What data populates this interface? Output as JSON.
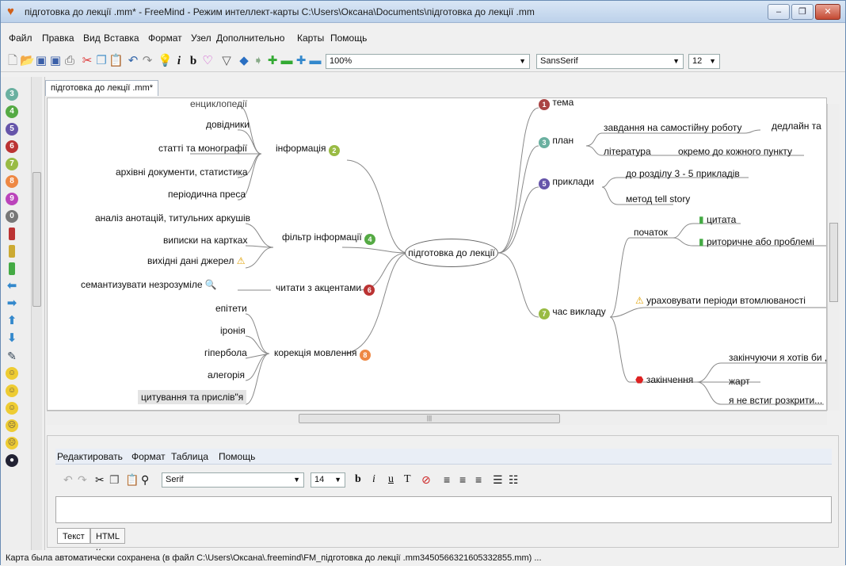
{
  "window": {
    "title": "підготовка до лекції .mm* - FreeMind - Режим интеллект-карты C:\\Users\\Оксана\\Documents\\підготовка до лекції .mm",
    "minimize": "–",
    "maximize": "❐",
    "close": "✕"
  },
  "menu": [
    "Файл",
    "Правка",
    "Вид",
    "Вставка",
    "Формат",
    "Узел",
    "Дополнительно",
    "Карты",
    "Помощь"
  ],
  "toolbar": {
    "zoom": "100%",
    "font": "SansSerif",
    "size": "12"
  },
  "tab": "підготовка до лекції .mm*",
  "map": {
    "central": "підготовка до лекції",
    "left": {
      "info": {
        "label": "інформація",
        "icon": "2",
        "children": [
          "енциклопедії",
          "довідники",
          "статті та монографії",
          "архівні документи, статистика",
          "періодична преса"
        ]
      },
      "filter": {
        "label": "фільтр інформації",
        "icon": "4",
        "children": [
          "аналіз анотацій, титульних аркушів",
          "виписки на картках",
          "вихідні дані джерел"
        ]
      },
      "read": {
        "label": "читати з акцентами",
        "icon": "6",
        "children": [
          "семантизувати незрозуміле"
        ]
      },
      "speech": {
        "label": "корекція мовлення",
        "icon": "8",
        "children": [
          "епітети",
          "іронія",
          "гіпербола",
          "алегорія",
          "цитування та прислів\"я"
        ]
      }
    },
    "right": {
      "theme": {
        "label": "тема",
        "icon": "1"
      },
      "plan": {
        "label": "план",
        "icon": "3",
        "children": [
          "завдання на самостійну роботу",
          "література"
        ],
        "grand": [
          "дедлайн та",
          "окремо до кожного пункту"
        ]
      },
      "examples": {
        "label": "приклади",
        "icon": "5",
        "children": [
          "до розділу 3 - 5 прикладів",
          "метод tell story"
        ]
      },
      "time": {
        "label": "час викладу",
        "icon": "7",
        "start": "початок",
        "start_children": [
          "цитата",
          "риторичне або проблемі"
        ],
        "warn": "ураховувати періоди втомлюваності",
        "end": "закінчення",
        "end_children": [
          "закінчуючи я хотів би ,",
          "жарт",
          "я не встиг розкрити..."
        ]
      }
    }
  },
  "editor": {
    "menu": [
      "Редактировать",
      "Формат",
      "Таблица",
      "Помощь"
    ],
    "font": "Serif",
    "size": "14",
    "tabs": [
      "Текст",
      "HTML Код"
    ]
  },
  "status": "Карта была автоматически сохранена (в файл C:\\Users\\Оксана\\.freemind\\FM_підготовка до лекції .mm3450566321605332855.mm) ..."
}
